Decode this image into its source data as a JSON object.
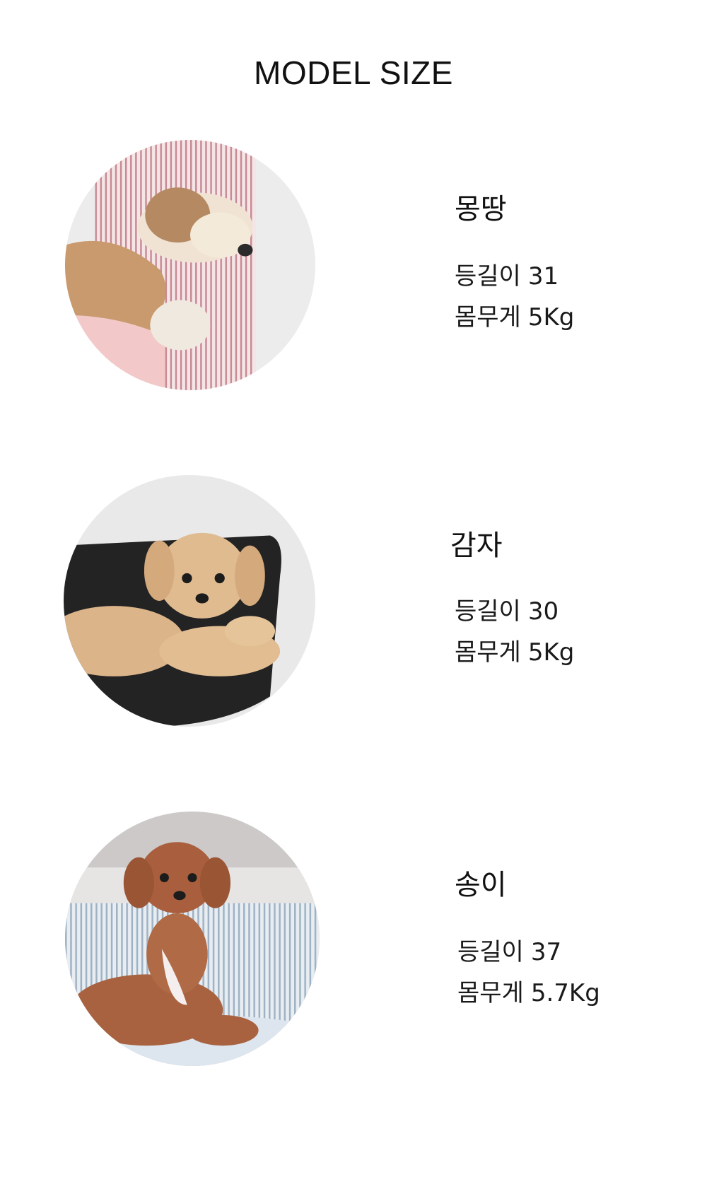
{
  "title": "MODEL SIZE",
  "models": [
    {
      "name": "몽땅",
      "back_label": "등길이",
      "back_value": "31",
      "weight_label": "몸무게",
      "weight_value": "5Kg",
      "photo_icon": "sleeping-dog-photo"
    },
    {
      "name": "감자",
      "back_label": "등길이",
      "back_value": "30",
      "weight_label": "몸무게",
      "weight_value": "5Kg",
      "photo_icon": "lying-dog-photo"
    },
    {
      "name": "송이",
      "back_label": "등길이",
      "back_value": "37",
      "weight_label": "몸무게",
      "weight_value": "5.7Kg",
      "photo_icon": "sitting-dog-photo"
    }
  ],
  "colors": {
    "text": "#111111",
    "background": "#ffffff",
    "pink_stripe": "#c98a93",
    "black_cushion": "#232323",
    "blue_stripe": "#9fb2c4",
    "fur_light": "#d9b48a",
    "fur_red": "#a8623f"
  }
}
